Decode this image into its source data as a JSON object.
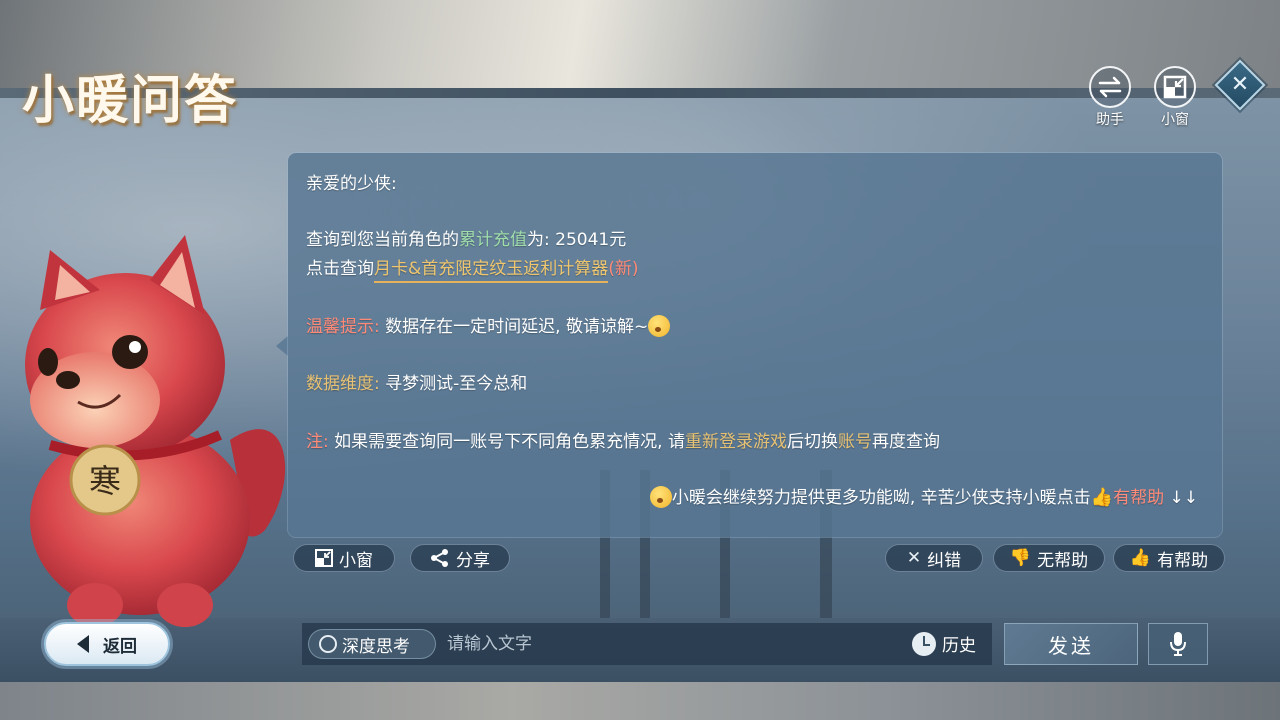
{
  "app": {
    "title": "小暖问答"
  },
  "top_buttons": {
    "assistant_label": "助手",
    "assistant_icon": "swap-arrows-icon",
    "mini_window_label": "小窗",
    "mini_window_icon": "minimize-window-icon",
    "close_icon": "close-x-icon"
  },
  "message": {
    "greeting": "亲爱的少侠:",
    "query_prefix": "查询到您当前角色的",
    "query_highlight": "累计充值",
    "query_suffix": "为: 25041元",
    "click_prefix": "点击查询",
    "calculator_link": "月卡&首充限定纹玉返利计算器",
    "calculator_new": "(新)",
    "tip_label": "温馨提示:",
    "tip_text": "数据存在一定时间延迟, 敬请谅解~",
    "dimension_label": "数据维度:",
    "dimension_text": "寻梦测试-至今总和",
    "note_label": "注:",
    "note_part1": "如果需要查询同一账号下不同角色累充情况, 请",
    "note_relogin": "重新登录游戏",
    "note_part2": "后切换",
    "note_account": "账号",
    "note_part3": "再度查询",
    "closing_text": "小暖会继续努力提供更多功能呦, 辛苦少侠支持小暖点击",
    "closing_helpful": "有帮助",
    "closing_arrows": "↓↓"
  },
  "actions": {
    "mini_window": "小窗",
    "share": "分享",
    "correct": "纠错",
    "not_helpful": "无帮助",
    "helpful": "有帮助"
  },
  "bottom": {
    "back_label": "返回",
    "deep_think_label": "深度思考",
    "input_placeholder": "请输入文字",
    "history_label": "历史",
    "send_label": "发送",
    "mic_icon": "microphone-icon"
  },
  "mascot": {
    "tag_text": "寒"
  },
  "colors": {
    "gold": "#e7c173",
    "green": "#9fdcaa",
    "red": "#ff8a78",
    "panel": "#58768f"
  }
}
